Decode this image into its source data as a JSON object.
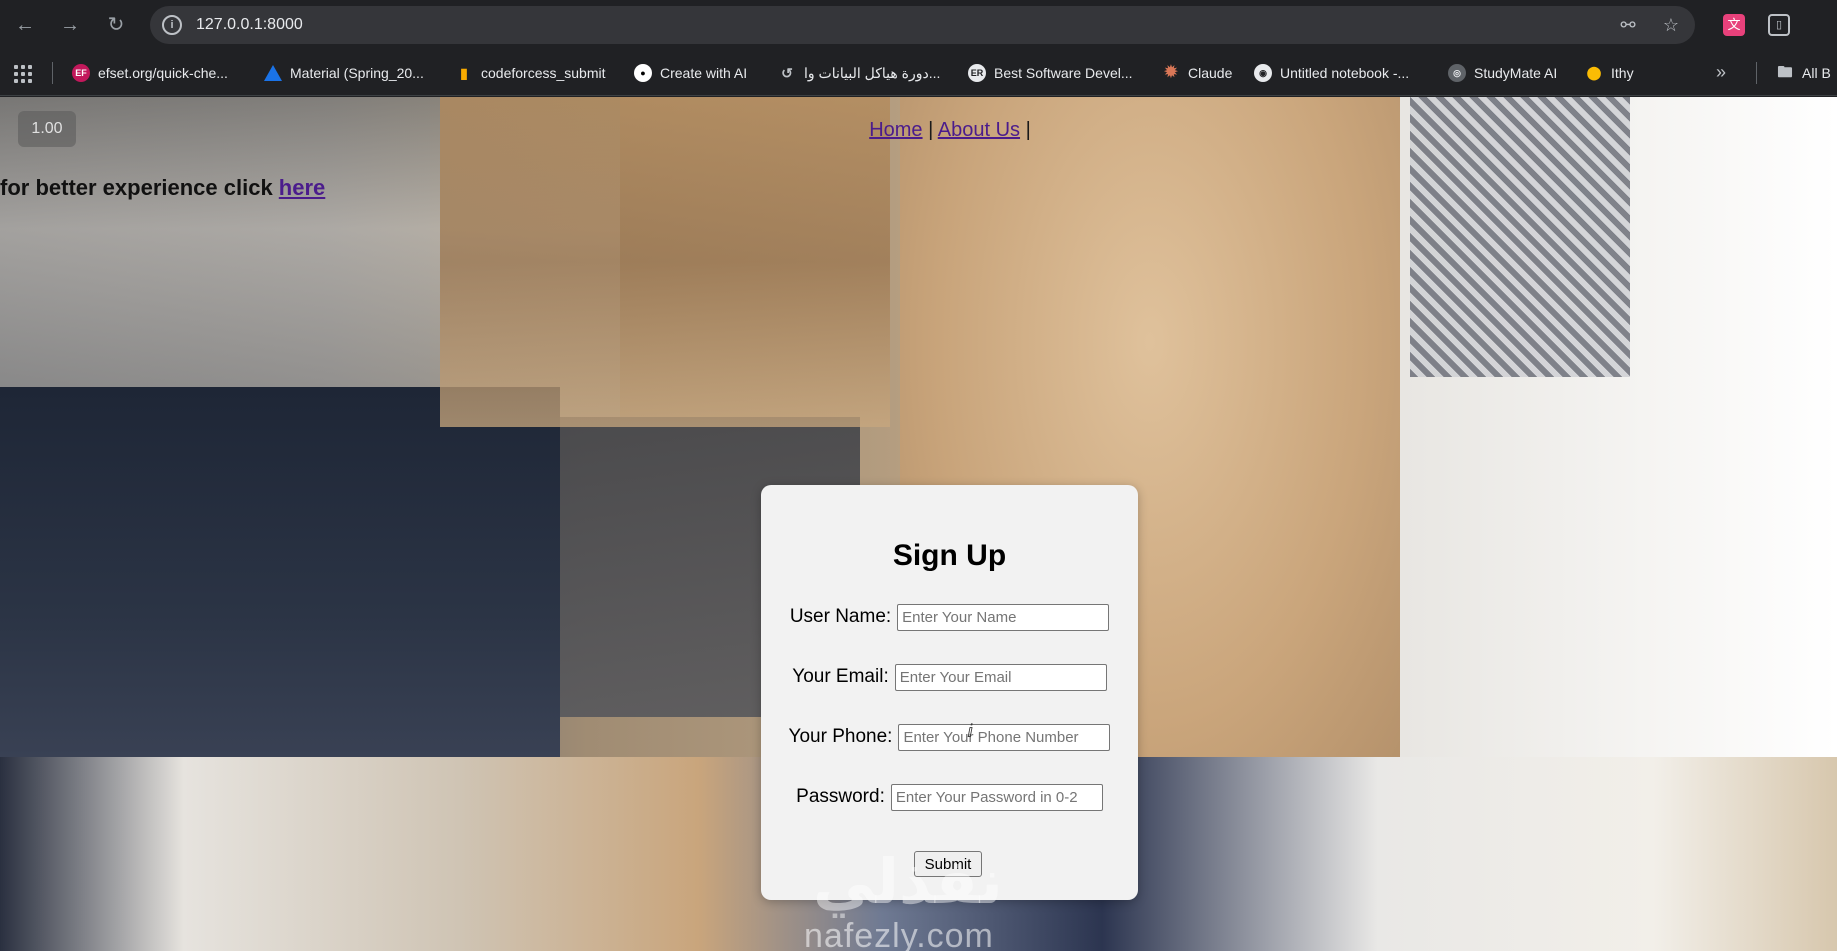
{
  "browser": {
    "url": "127.0.0.1:8000",
    "bookmarks": [
      {
        "label": "efset.org/quick-che...",
        "icon": "ef-icon",
        "color": "#c2185b"
      },
      {
        "label": "Material (Spring_20...",
        "icon": "drive-icon",
        "color": "#1a73e8"
      },
      {
        "label": "codeforcess_submit",
        "icon": "chart-icon",
        "color": "#f9ab00"
      },
      {
        "label": "Create with AI",
        "icon": "robot-icon",
        "color": "#ffffff"
      },
      {
        "label": "دورة هياكل البيانات وا...",
        "icon": "refresh-icon",
        "color": "#bdc1c6"
      },
      {
        "label": "Best Software Devel...",
        "icon": "er-icon",
        "color": "#e8eaed"
      },
      {
        "label": "Claude",
        "icon": "claude-icon",
        "color": "#d97757"
      },
      {
        "label": "Untitled notebook -...",
        "icon": "notebook-icon",
        "color": "#e8eaed"
      },
      {
        "label": "StudyMate AI",
        "icon": "globe-icon",
        "color": "#bdc1c6"
      },
      {
        "label": "Ithy",
        "icon": "ithy-icon",
        "color": "#fbbc04"
      },
      {
        "label": "All B",
        "icon": "folder-icon",
        "color": "#bdc1c6"
      }
    ]
  },
  "page": {
    "zoom": "1.00",
    "nav": {
      "home": "Home",
      "sep1": " | ",
      "about": "About Us",
      "sep2": " |"
    },
    "promo": {
      "text": "for better experience click ",
      "link": "here"
    },
    "form": {
      "title": "Sign Up",
      "fields": [
        {
          "label": "User Name:",
          "placeholder": "Enter Your Name"
        },
        {
          "label": "Your Email:",
          "placeholder": "Enter Your Email"
        },
        {
          "label": "Your Phone:",
          "placeholder": "Enter Your Phone Number"
        },
        {
          "label": "Password:",
          "placeholder": "Enter Your Password in 0-2"
        }
      ],
      "submit": "Submit"
    },
    "watermark": "nafezly.com",
    "watermark_ar": "نفذلي"
  }
}
